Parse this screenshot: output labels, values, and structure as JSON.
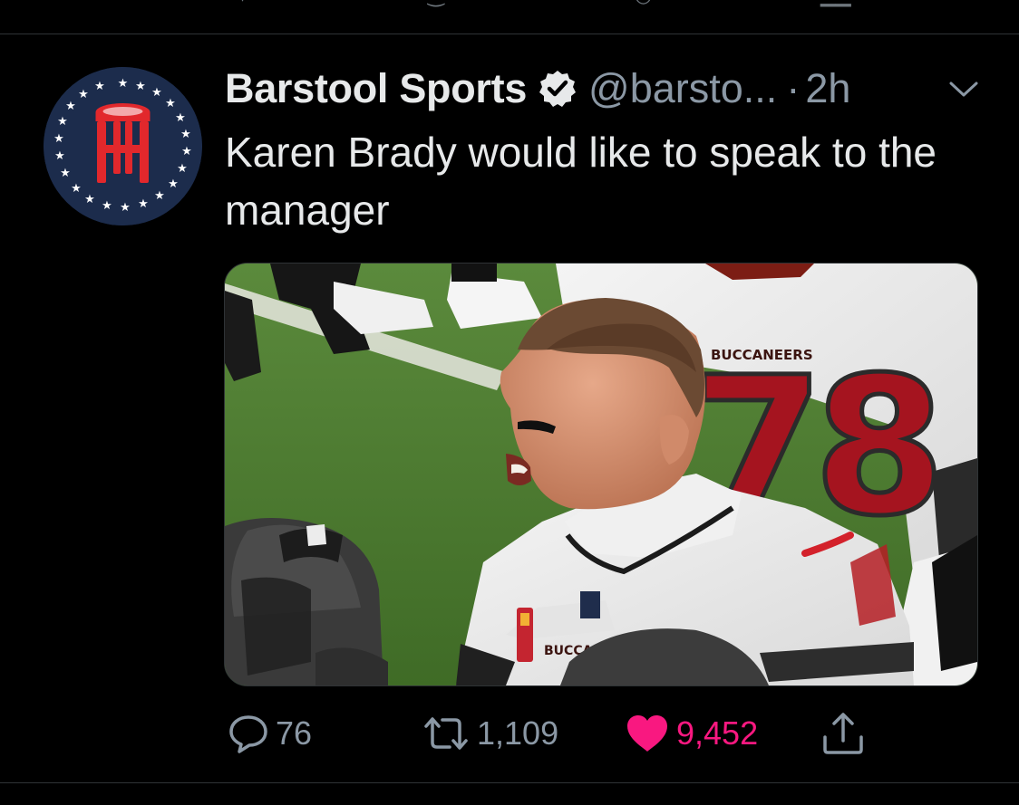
{
  "tweet": {
    "author_name": "Barstool Sports",
    "handle": "@barsto...",
    "separator": "·",
    "timestamp": "2h",
    "text": "Karen Brady would like to speak to the manager",
    "verified": true,
    "menu_icon": "chevron-down-icon"
  },
  "media": {
    "jersey_text_1": "BUCCANEERS",
    "jersey_number": "78",
    "jersey_text_2": "BUCCANEERS"
  },
  "actions": {
    "reply_count": "76",
    "retweet_count": "1,109",
    "like_count": "9,452",
    "liked": true,
    "like_color": "#f91880",
    "icons": [
      "reply-icon",
      "retweet-icon",
      "heart-icon",
      "share-icon"
    ]
  },
  "colors": {
    "background": "#000000",
    "text": "#e7e9ea",
    "muted": "#8b98a5",
    "divider": "#2f3336"
  }
}
